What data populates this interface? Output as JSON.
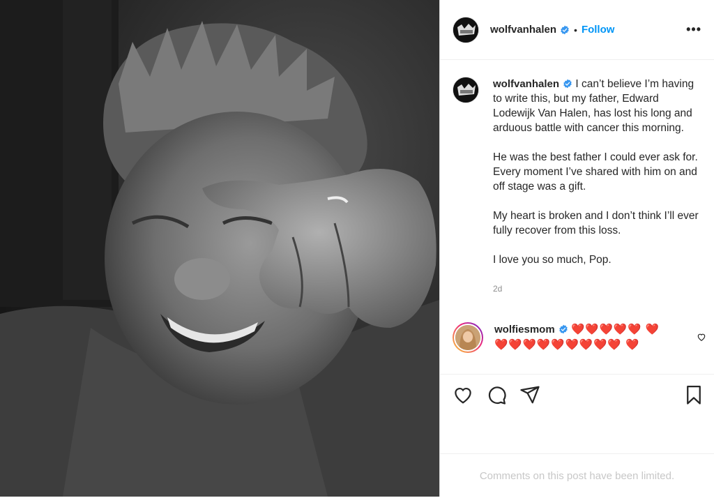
{
  "post": {
    "username": "wolfvanhalen",
    "follow_label": "Follow",
    "dot": "•",
    "more": "•••",
    "image_alt": "Black and white photo of a smiling man holding his hand to his eye"
  },
  "caption": {
    "username": "wolfvanhalen",
    "paragraphs": [
      "I can’t believe I’m having to write this, but my father, Edward Lodewijk Van Halen, has lost his long and arduous battle with cancer this morning.",
      "He was the best father I could ever ask for. Every moment I’ve shared with him on and off stage was a gift.",
      "My heart is broken and I don’t think I’ll ever fully recover from this loss.",
      "I love you so much, Pop."
    ],
    "time": "2d"
  },
  "comment": {
    "username": "wolfiesmom",
    "text": "❤️❤️❤️❤️❤️ ❤️❤️❤️❤️❤️❤️❤️❤️❤️❤️ ❤️"
  },
  "footer": {
    "limited_text": "Comments on this post have been limited."
  },
  "colors": {
    "link": "#0095f6",
    "verified": "#3897f0",
    "muted": "#8e8e8e",
    "heart": "#c4122a"
  },
  "icons": [
    "verified-badge-icon",
    "more-options-icon",
    "like-icon",
    "comment-icon",
    "share-icon",
    "save-icon",
    "comment-like-icon"
  ]
}
